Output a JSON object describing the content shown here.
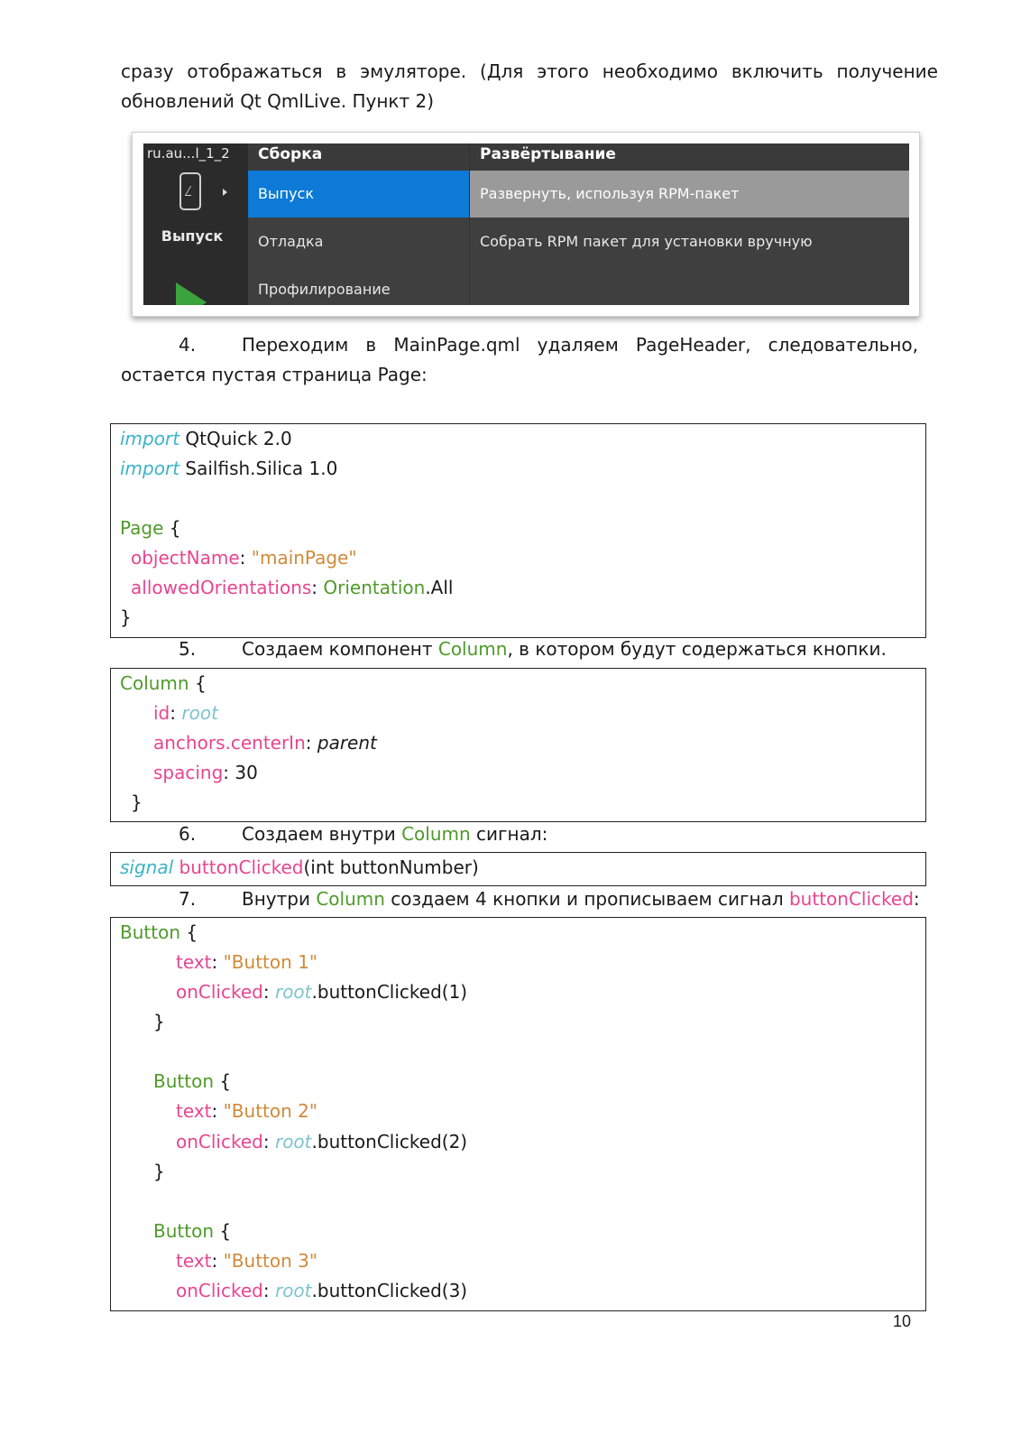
{
  "intro": {
    "line1": "сразу отображаться в эмуляторе. (Для этого необходимо включить получение",
    "line2": "обновлений Qt QmlLive. Пункт 2)"
  },
  "screenshot": {
    "kit_name": "ru.au...l_1_2",
    "kit_mode": "Выпуск",
    "build_header": "Сборка",
    "deploy_header": "Развёртывание",
    "build_items": [
      "Выпуск",
      "Отладка",
      "Профилирование"
    ],
    "deploy_items": [
      "Развернуть, используя RPM-пакет",
      "Собрать RPM пакет для установки вручную"
    ],
    "colors": {
      "selected_build": "#0c7ad6",
      "selected_deploy": "#9a9a9a",
      "background": "#3f3f3f",
      "run_icon": "#3ba33b"
    },
    "icons": [
      "device-icon",
      "chevron-right-icon",
      "run-icon"
    ]
  },
  "step4": {
    "num": "4.",
    "line1": "Переходим в MainPage.qml удаляем PageHeader, следовательно,",
    "line2": "остается пустая страница Page:"
  },
  "code1": {
    "l1_kw": "import",
    "l1_rest": " QtQuick 2.0",
    "l2_kw": "import",
    "l2_rest": " Sailfish.Silica 1.0",
    "l3_ty": "Page",
    "l3_rest": " {",
    "l4_pr": "objectName",
    "l4_sep": ": ",
    "l4_st": "\"mainPage\"",
    "l5_pr": "allowedOrientations",
    "l5_sep": ": ",
    "l5_ty": "Orientation",
    "l5_rest": ".All",
    "l6": "}"
  },
  "step5": {
    "num": "5.",
    "pre": "Создаем компонент ",
    "ty": "Column",
    "post": ", в котором будут содержаться кнопки."
  },
  "code2": {
    "l1_ty": "Column",
    "l1_rest": " {",
    "l2_pr": "id",
    "l2_sep": ": ",
    "l2_rt": "root",
    "l3_pr": "anchors.centerIn",
    "l3_sep": ": ",
    "l3_it": "parent",
    "l4_pr": "spacing",
    "l4_rest": ": 30",
    "l5": "}"
  },
  "step6": {
    "num": "6.",
    "pre": "Создаем внутри ",
    "ty": "Column",
    "post": " сигнал:"
  },
  "code3": {
    "kw": "signal",
    "sp": " ",
    "pr": "buttonClicked",
    "rest": "(int buttonNumber)"
  },
  "step7": {
    "num": "7.",
    "pre": "Внутри ",
    "ty": "Column",
    "mid": " создаем 4 кнопки и прописываем сигнал ",
    "pr": "buttonClicked",
    "post": ":"
  },
  "code4": {
    "b1_ty": "Button",
    "b1_open": " {",
    "b1_text_pr": "text",
    "b1_text_sep": ": ",
    "b1_text_st": "\"Button 1\"",
    "b1_click_pr": "onClicked",
    "b1_click_sep": ": ",
    "b1_click_rt": "root",
    "b1_click_rest": ".buttonClicked(1)",
    "b1_close": "}",
    "b2_ty": "Button",
    "b2_open": " {",
    "b2_text_pr": "text",
    "b2_text_sep": ": ",
    "b2_text_st": "\"Button 2\"",
    "b2_click_pr": "onClicked",
    "b2_click_sep": ": ",
    "b2_click_rt": "root",
    "b2_click_rest": ".buttonClicked(2)",
    "b2_close": "}",
    "b3_ty": "Button",
    "b3_open": " {",
    "b3_text_pr": "text",
    "b3_text_sep": ": ",
    "b3_text_st": "\"Button 3\"",
    "b3_click_pr": "onClicked",
    "b3_click_sep": ": ",
    "b3_click_rt": "root",
    "b3_click_rest": ".buttonClicked(3)"
  },
  "page_number": "10"
}
